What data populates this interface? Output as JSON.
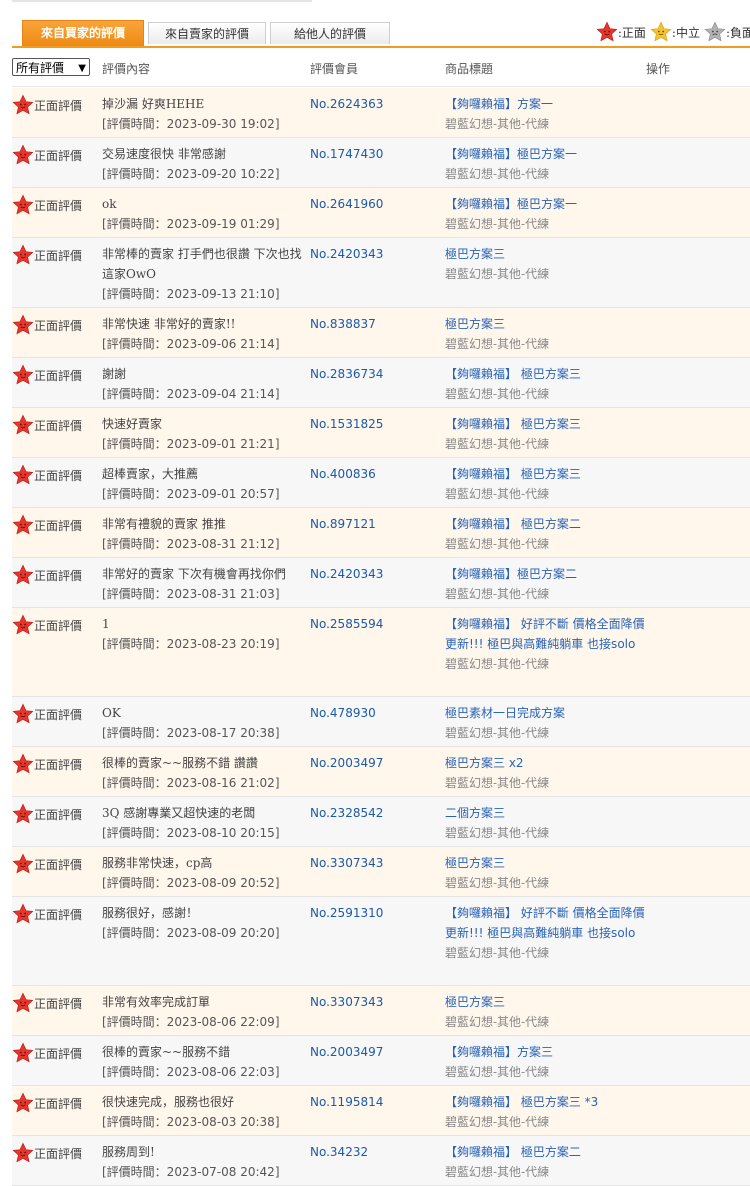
{
  "tabs": [
    {
      "label": "來自買家的評價",
      "active": true
    },
    {
      "label": "來自賣家的評價",
      "active": false
    },
    {
      "label": "給他人的評價",
      "active": false
    }
  ],
  "legend": [
    {
      "icon": "red-star-icon",
      "label": ":正面",
      "color": "#e8362c"
    },
    {
      "icon": "yellow-star-icon",
      "label": ":中立",
      "color": "#f4c430"
    },
    {
      "icon": "gray-star-icon",
      "label": ":負面",
      "color": "#b3b3b3"
    }
  ],
  "header": {
    "filter_value": "所有評價",
    "col_content": "評價內容",
    "col_member": "評價會員",
    "col_title": "商品標題",
    "col_action": "操作"
  },
  "rows": [
    {
      "rating": "正面評價",
      "text": "掉沙漏 好爽HEHE",
      "time": "[評價時間：2023-09-30 19:02]",
      "member": "No.2624363",
      "product": "【夠囉賴福】方案一",
      "category": "碧藍幻想-其他-代練"
    },
    {
      "rating": "正面評價",
      "text": "交易速度很快 非常感謝",
      "time": "[評價時間：2023-09-20 10:22]",
      "member": "No.1747430",
      "product": "【夠囉賴福】極巴方案一",
      "category": "碧藍幻想-其他-代練"
    },
    {
      "rating": "正面評價",
      "text": "ok",
      "time": "[評價時間：2023-09-19 01:29]",
      "member": "No.2641960",
      "product": "【夠囉賴福】極巴方案一",
      "category": "碧藍幻想-其他-代練"
    },
    {
      "rating": "正面評價",
      "text": "非常棒的賣家 打手們也很讚 下次也找這家OwO",
      "time": "[評價時間：2023-09-13 21:10]",
      "member": "No.2420343",
      "product": "極巴方案三",
      "category": "碧藍幻想-其他-代練"
    },
    {
      "rating": "正面評價",
      "text": "非常快速 非常好的賣家!!",
      "time": "[評價時間：2023-09-06 21:14]",
      "member": "No.838837",
      "product": "極巴方案三",
      "category": "碧藍幻想-其他-代練"
    },
    {
      "rating": "正面評價",
      "text": "謝謝",
      "time": "[評價時間：2023-09-04 21:14]",
      "member": "No.2836734",
      "product": "【夠囉賴福】 極巴方案三",
      "category": "碧藍幻想-其他-代練"
    },
    {
      "rating": "正面評價",
      "text": "快速好賣家",
      "time": "[評價時間：2023-09-01 21:21]",
      "member": "No.1531825",
      "product": "【夠囉賴福】 極巴方案三",
      "category": "碧藍幻想-其他-代練"
    },
    {
      "rating": "正面評價",
      "text": "超棒賣家，大推薦",
      "time": "[評價時間：2023-09-01 20:57]",
      "member": "No.400836",
      "product": "【夠囉賴福】 極巴方案三",
      "category": "碧藍幻想-其他-代練"
    },
    {
      "rating": "正面評價",
      "text": "非常有禮貌的賣家 推推",
      "time": "[評價時間：2023-08-31 21:12]",
      "member": "No.897121",
      "product": "【夠囉賴福】 極巴方案二",
      "category": "碧藍幻想-其他-代練"
    },
    {
      "rating": "正面評價",
      "text": "非常好的賣家 下次有機會再找你們",
      "time": "[評價時間：2023-08-31 21:03]",
      "member": "No.2420343",
      "product": "【夠囉賴福】極巴方案二",
      "category": "碧藍幻想-其他-代練"
    },
    {
      "rating": "正面評價",
      "text": "1",
      "time": "[評價時間：2023-08-23 20:19]",
      "member": "No.2585594",
      "product": "【夠囉賴福】 好評不斷 價格全面降價更新!!! 極巴與高難純躺車 也接solo",
      "category": "碧藍幻想-其他-代練"
    },
    {
      "rating": "正面評價",
      "text": "OK",
      "time": "[評價時間：2023-08-17 20:38]",
      "member": "No.478930",
      "product": "極巴素材一日完成方案",
      "category": "碧藍幻想-其他-代練"
    },
    {
      "rating": "正面評價",
      "text": "很棒的賣家~~服務不錯 讚讚",
      "time": "[評價時間：2023-08-16 21:02]",
      "member": "No.2003497",
      "product": "極巴方案三 x2",
      "category": "碧藍幻想-其他-代練"
    },
    {
      "rating": "正面評價",
      "text": "3Q 感謝專業又超快速的老闆",
      "time": "[評價時間：2023-08-10 20:15]",
      "member": "No.2328542",
      "product": "二個方案三",
      "category": "碧藍幻想-其他-代練"
    },
    {
      "rating": "正面評價",
      "text": "服務非常快速，cp高",
      "time": "[評價時間：2023-08-09 20:52]",
      "member": "No.3307343",
      "product": "極巴方案三",
      "category": "碧藍幻想-其他-代練"
    },
    {
      "rating": "正面評價",
      "text": "服務很好，感謝！",
      "time": "[評價時間：2023-08-09 20:20]",
      "member": "No.2591310",
      "product": "【夠囉賴福】 好評不斷 價格全面降價更新!!! 極巴與高難純躺車 也接solo",
      "category": "碧藍幻想-其他-代練"
    },
    {
      "rating": "正面評價",
      "text": "非常有效率完成訂單",
      "time": "[評價時間：2023-08-06 22:09]",
      "member": "No.3307343",
      "product": "極巴方案三",
      "category": "碧藍幻想-其他-代練"
    },
    {
      "rating": "正面評價",
      "text": "很棒的賣家~~服務不錯",
      "time": "[評價時間：2023-08-06 22:03]",
      "member": "No.2003497",
      "product": "【夠囉賴福】方案三",
      "category": "碧藍幻想-其他-代練"
    },
    {
      "rating": "正面評價",
      "text": "很快速完成，服務也很好",
      "time": "[評價時間：2023-08-03 20:38]",
      "member": "No.1195814",
      "product": "【夠囉賴福】 極巴方案三 *3",
      "category": "碧藍幻想-其他-代練"
    },
    {
      "rating": "正面評價",
      "text": "服務周到!",
      "time": "[評價時間：2023-07-08 20:42]",
      "member": "No.34232",
      "product": "【夠囉賴福】 極巴方案二",
      "category": "碧藍幻想-其他-代練"
    }
  ]
}
